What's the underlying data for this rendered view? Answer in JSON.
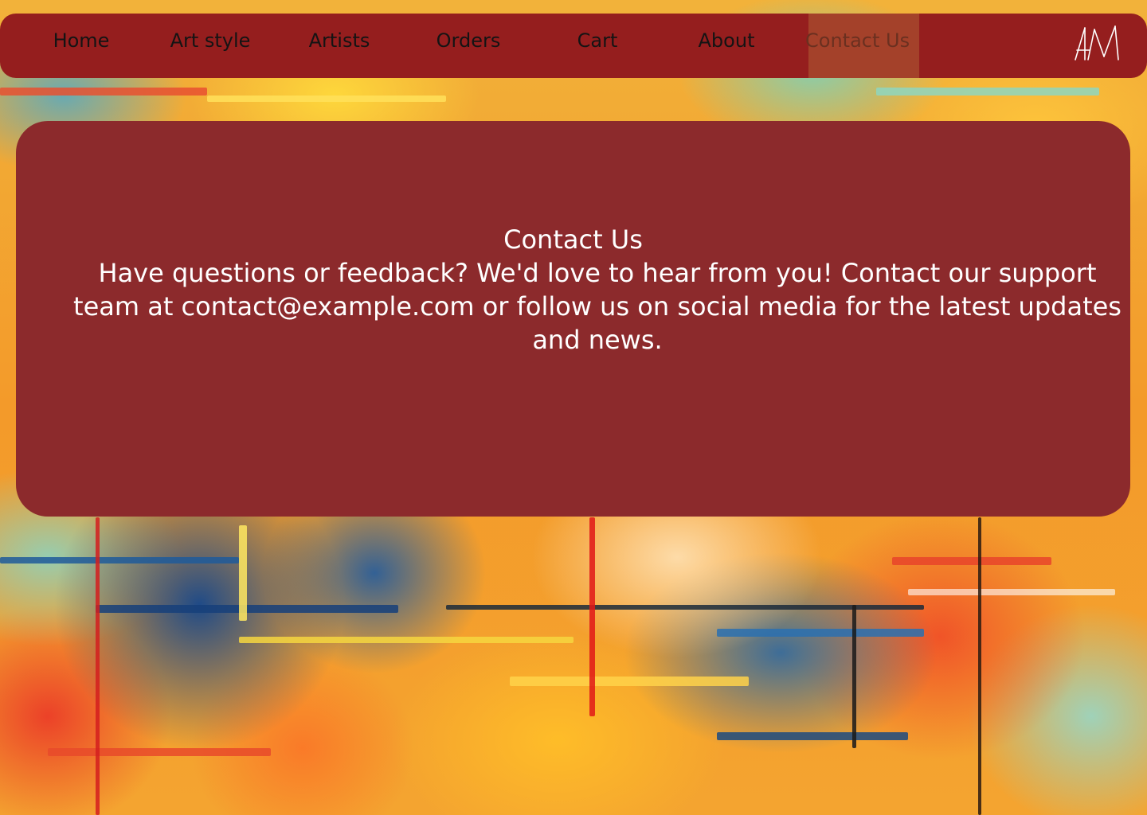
{
  "nav": {
    "items": [
      {
        "label": "Home"
      },
      {
        "label": "Art style"
      },
      {
        "label": "Artists"
      },
      {
        "label": "Orders"
      },
      {
        "label": "Cart"
      },
      {
        "label": "About"
      },
      {
        "label": "Contact Us"
      }
    ],
    "active": "Contact Us",
    "logo_text": "AM",
    "logo_icon": "am-monogram-logo"
  },
  "main": {
    "title": "Contact Us",
    "body": "Have questions or feedback? We'd love to hear from you! Contact our support team at contact@example.com or follow us on social media for the latest updates and news."
  },
  "colors": {
    "nav_background": "#951e1e",
    "active_tab_background": "#a4412a",
    "card_background": "#8c2a2c",
    "card_text": "#ffffff",
    "nav_text": "#141414"
  }
}
